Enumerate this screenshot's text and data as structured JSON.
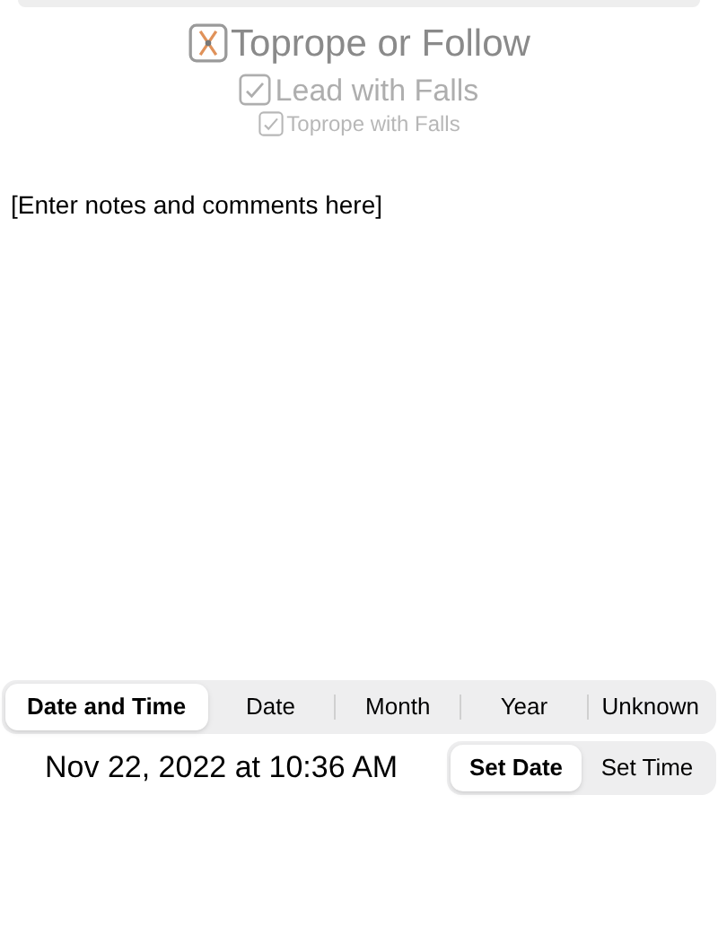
{
  "picker": {
    "items": [
      {
        "label": "Toprope or Follow",
        "selected": true
      },
      {
        "label": "Lead with Falls",
        "selected": false
      },
      {
        "label": "Toprope with Falls",
        "selected": false
      }
    ]
  },
  "notes": {
    "placeholder": "[Enter notes and comments here]"
  },
  "date_modes": [
    {
      "label": "Date and Time",
      "selected": true
    },
    {
      "label": "Date",
      "selected": false
    },
    {
      "label": "Month",
      "selected": false
    },
    {
      "label": "Year",
      "selected": false
    },
    {
      "label": "Unknown",
      "selected": false
    }
  ],
  "date_value": "Nov 22, 2022 at 10:36 AM",
  "set_modes": [
    {
      "label": "Set Date",
      "selected": true
    },
    {
      "label": "Set Time",
      "selected": false
    }
  ]
}
